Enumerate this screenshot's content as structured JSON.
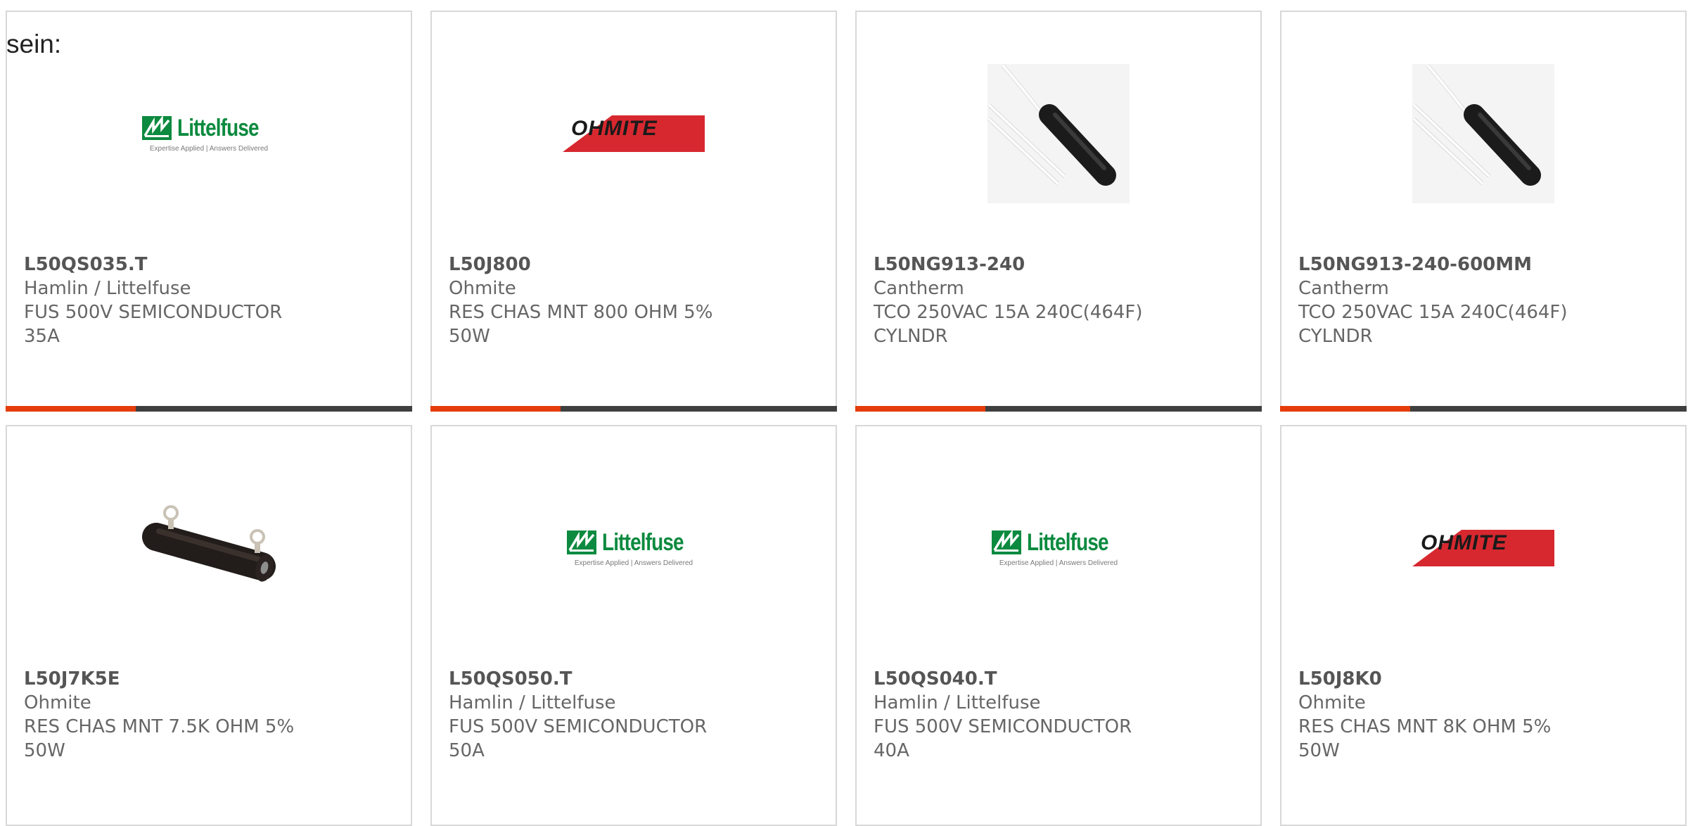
{
  "intro_text": "sein:",
  "colors": {
    "accent": "#e43c0b",
    "bar": "#3f3f3f",
    "littelfuse_green": "#0c8a3f",
    "ohmite_red": "#d7282f"
  },
  "logos": {
    "littelfuse": {
      "name": "Littelfuse",
      "tagline": "Expertise Applied | Answers Delivered"
    },
    "ohmite": {
      "name": "OHMITE"
    }
  },
  "products": [
    {
      "part": "L50QS035.T",
      "manufacturer": "Hamlin / Littelfuse",
      "description": "FUS 500V SEMICONDUCTOR 35A",
      "image": "littelfuse-logo",
      "progress": 0.32
    },
    {
      "part": "L50J800",
      "manufacturer": "Ohmite",
      "description": "RES CHAS MNT 800 OHM 5% 50W",
      "image": "ohmite-logo",
      "progress": 0.32
    },
    {
      "part": "L50NG913-240",
      "manufacturer": "Cantherm",
      "description": "TCO 250VAC 15A 240C(464F) CYLNDR",
      "image": "thermal-cutoff-photo",
      "progress": 0.32
    },
    {
      "part": "L50NG913-240-600MM",
      "manufacturer": "Cantherm",
      "description": "TCO 250VAC 15A 240C(464F) CYLNDR",
      "image": "thermal-cutoff-photo",
      "progress": 0.32
    },
    {
      "part": "L50J7K5E",
      "manufacturer": "Ohmite",
      "description": "RES CHAS MNT 7.5K OHM 5% 50W",
      "image": "chassis-resistor-photo",
      "progress": 0
    },
    {
      "part": "L50QS050.T",
      "manufacturer": "Hamlin / Littelfuse",
      "description": "FUS 500V SEMICONDUCTOR 50A",
      "image": "littelfuse-logo",
      "progress": 0
    },
    {
      "part": "L50QS040.T",
      "manufacturer": "Hamlin / Littelfuse",
      "description": "FUS 500V SEMICONDUCTOR 40A",
      "image": "littelfuse-logo",
      "progress": 0
    },
    {
      "part": "L50J8K0",
      "manufacturer": "Ohmite",
      "description": "RES CHAS MNT 8K OHM 5% 50W",
      "image": "ohmite-logo",
      "progress": 0
    }
  ]
}
